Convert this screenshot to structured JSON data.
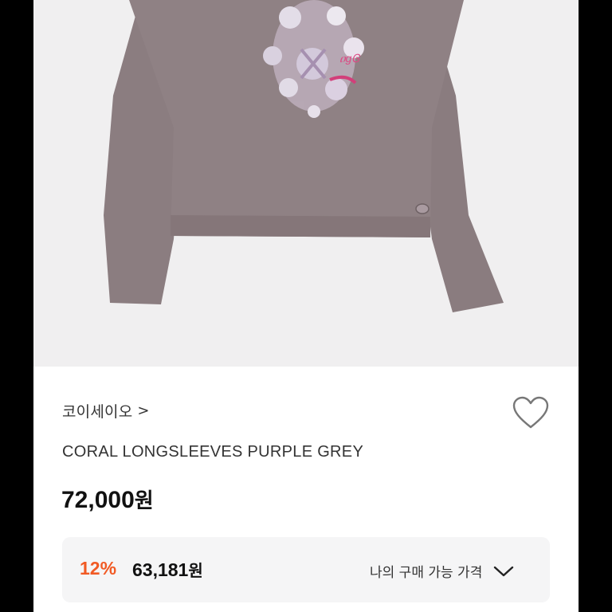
{
  "product": {
    "brand": "코이세이오",
    "brand_chevron": ">",
    "title": "CORAL LONGSLEEVES PURPLE GREY",
    "price_amount": "72,000",
    "price_unit": "원"
  },
  "discount": {
    "rate": "12%",
    "amount": "63,181",
    "unit": "원",
    "my_price_label": "나의 구매 가능 가격"
  },
  "colors": {
    "shirt": "#8a7b7f",
    "discount_accent": "#f15a24",
    "panel_bg": "#f5f5f6"
  },
  "icons": {
    "wishlist": "heart-icon",
    "expand": "chevron-down-icon",
    "brand_link": "chevron-right-icon"
  }
}
